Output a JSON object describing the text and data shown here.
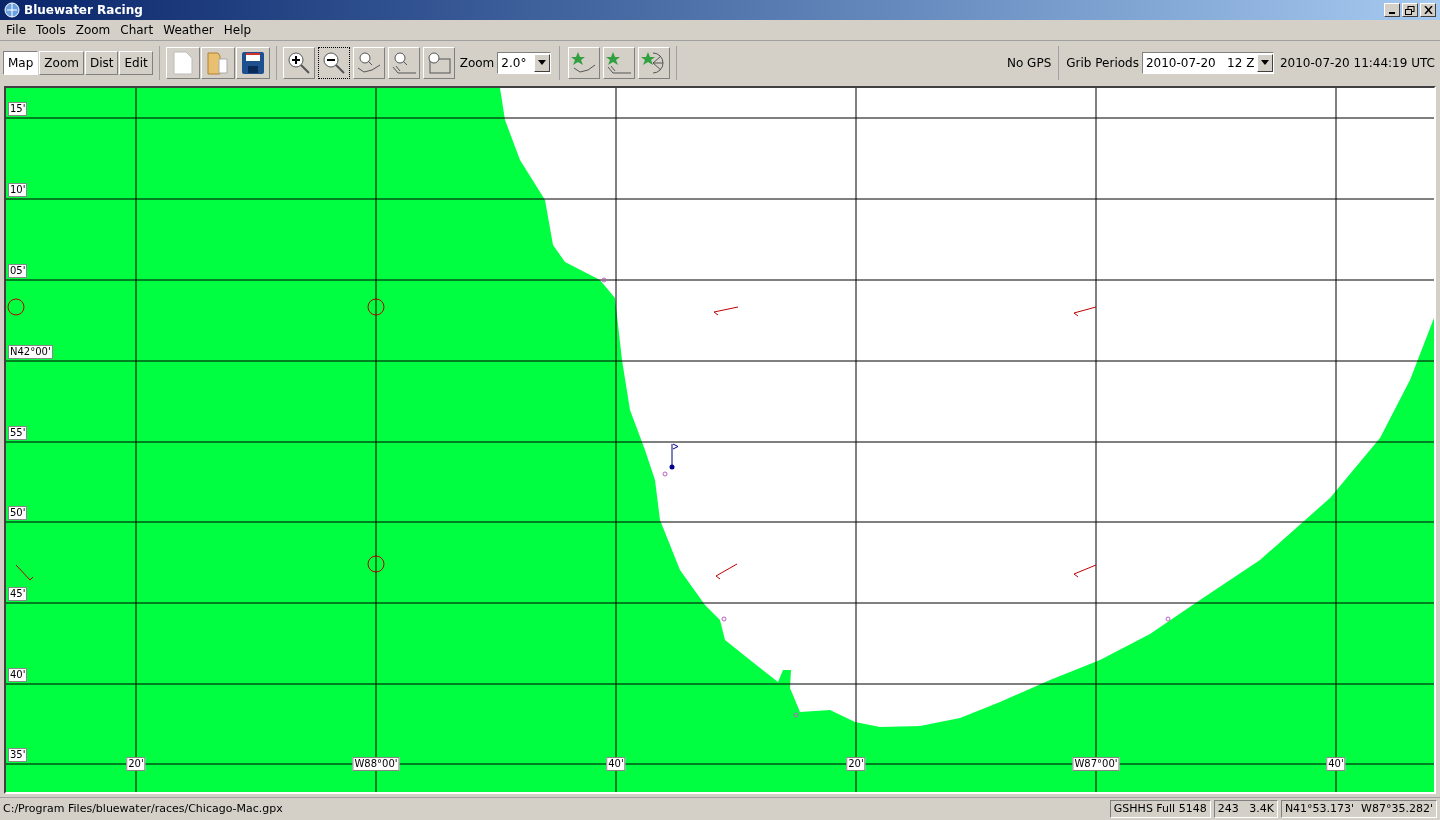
{
  "window": {
    "title": "Bluewater Racing"
  },
  "menu": [
    {
      "label": "File"
    },
    {
      "label": "Tools"
    },
    {
      "label": "Zoom"
    },
    {
      "label": "Chart"
    },
    {
      "label": "Weather"
    },
    {
      "label": "Help"
    }
  ],
  "toolbar": {
    "modes": [
      {
        "label": "Map",
        "selected": true
      },
      {
        "label": "Zoom",
        "selected": false
      },
      {
        "label": "Dist",
        "selected": false
      },
      {
        "label": "Edit",
        "selected": false
      }
    ],
    "zoom_label": "Zoom",
    "zoom_value": "2.0°",
    "gps_status": "No GPS",
    "grib_label": "Grib Periods",
    "grib_value": "2010-07-20   12 Z",
    "time": "2010-07-20 11:44:19 UTC"
  },
  "map": {
    "lat_labels": [
      "15'",
      "10'",
      "05'",
      "N42°00'",
      "55'",
      "50'",
      "45'",
      "40'",
      "35'"
    ],
    "lon_labels": [
      "20'",
      "W88°00'",
      "40'",
      "20'",
      "W87°00'",
      "40'"
    ]
  },
  "status_bar": {
    "path": "C:/Program Files/bluewater/races/Chicago-Mac.gpx",
    "fields": [
      "GSHHS Full 5148",
      "243   3.4K",
      "N41°53.173'  W87°35.282'"
    ]
  }
}
